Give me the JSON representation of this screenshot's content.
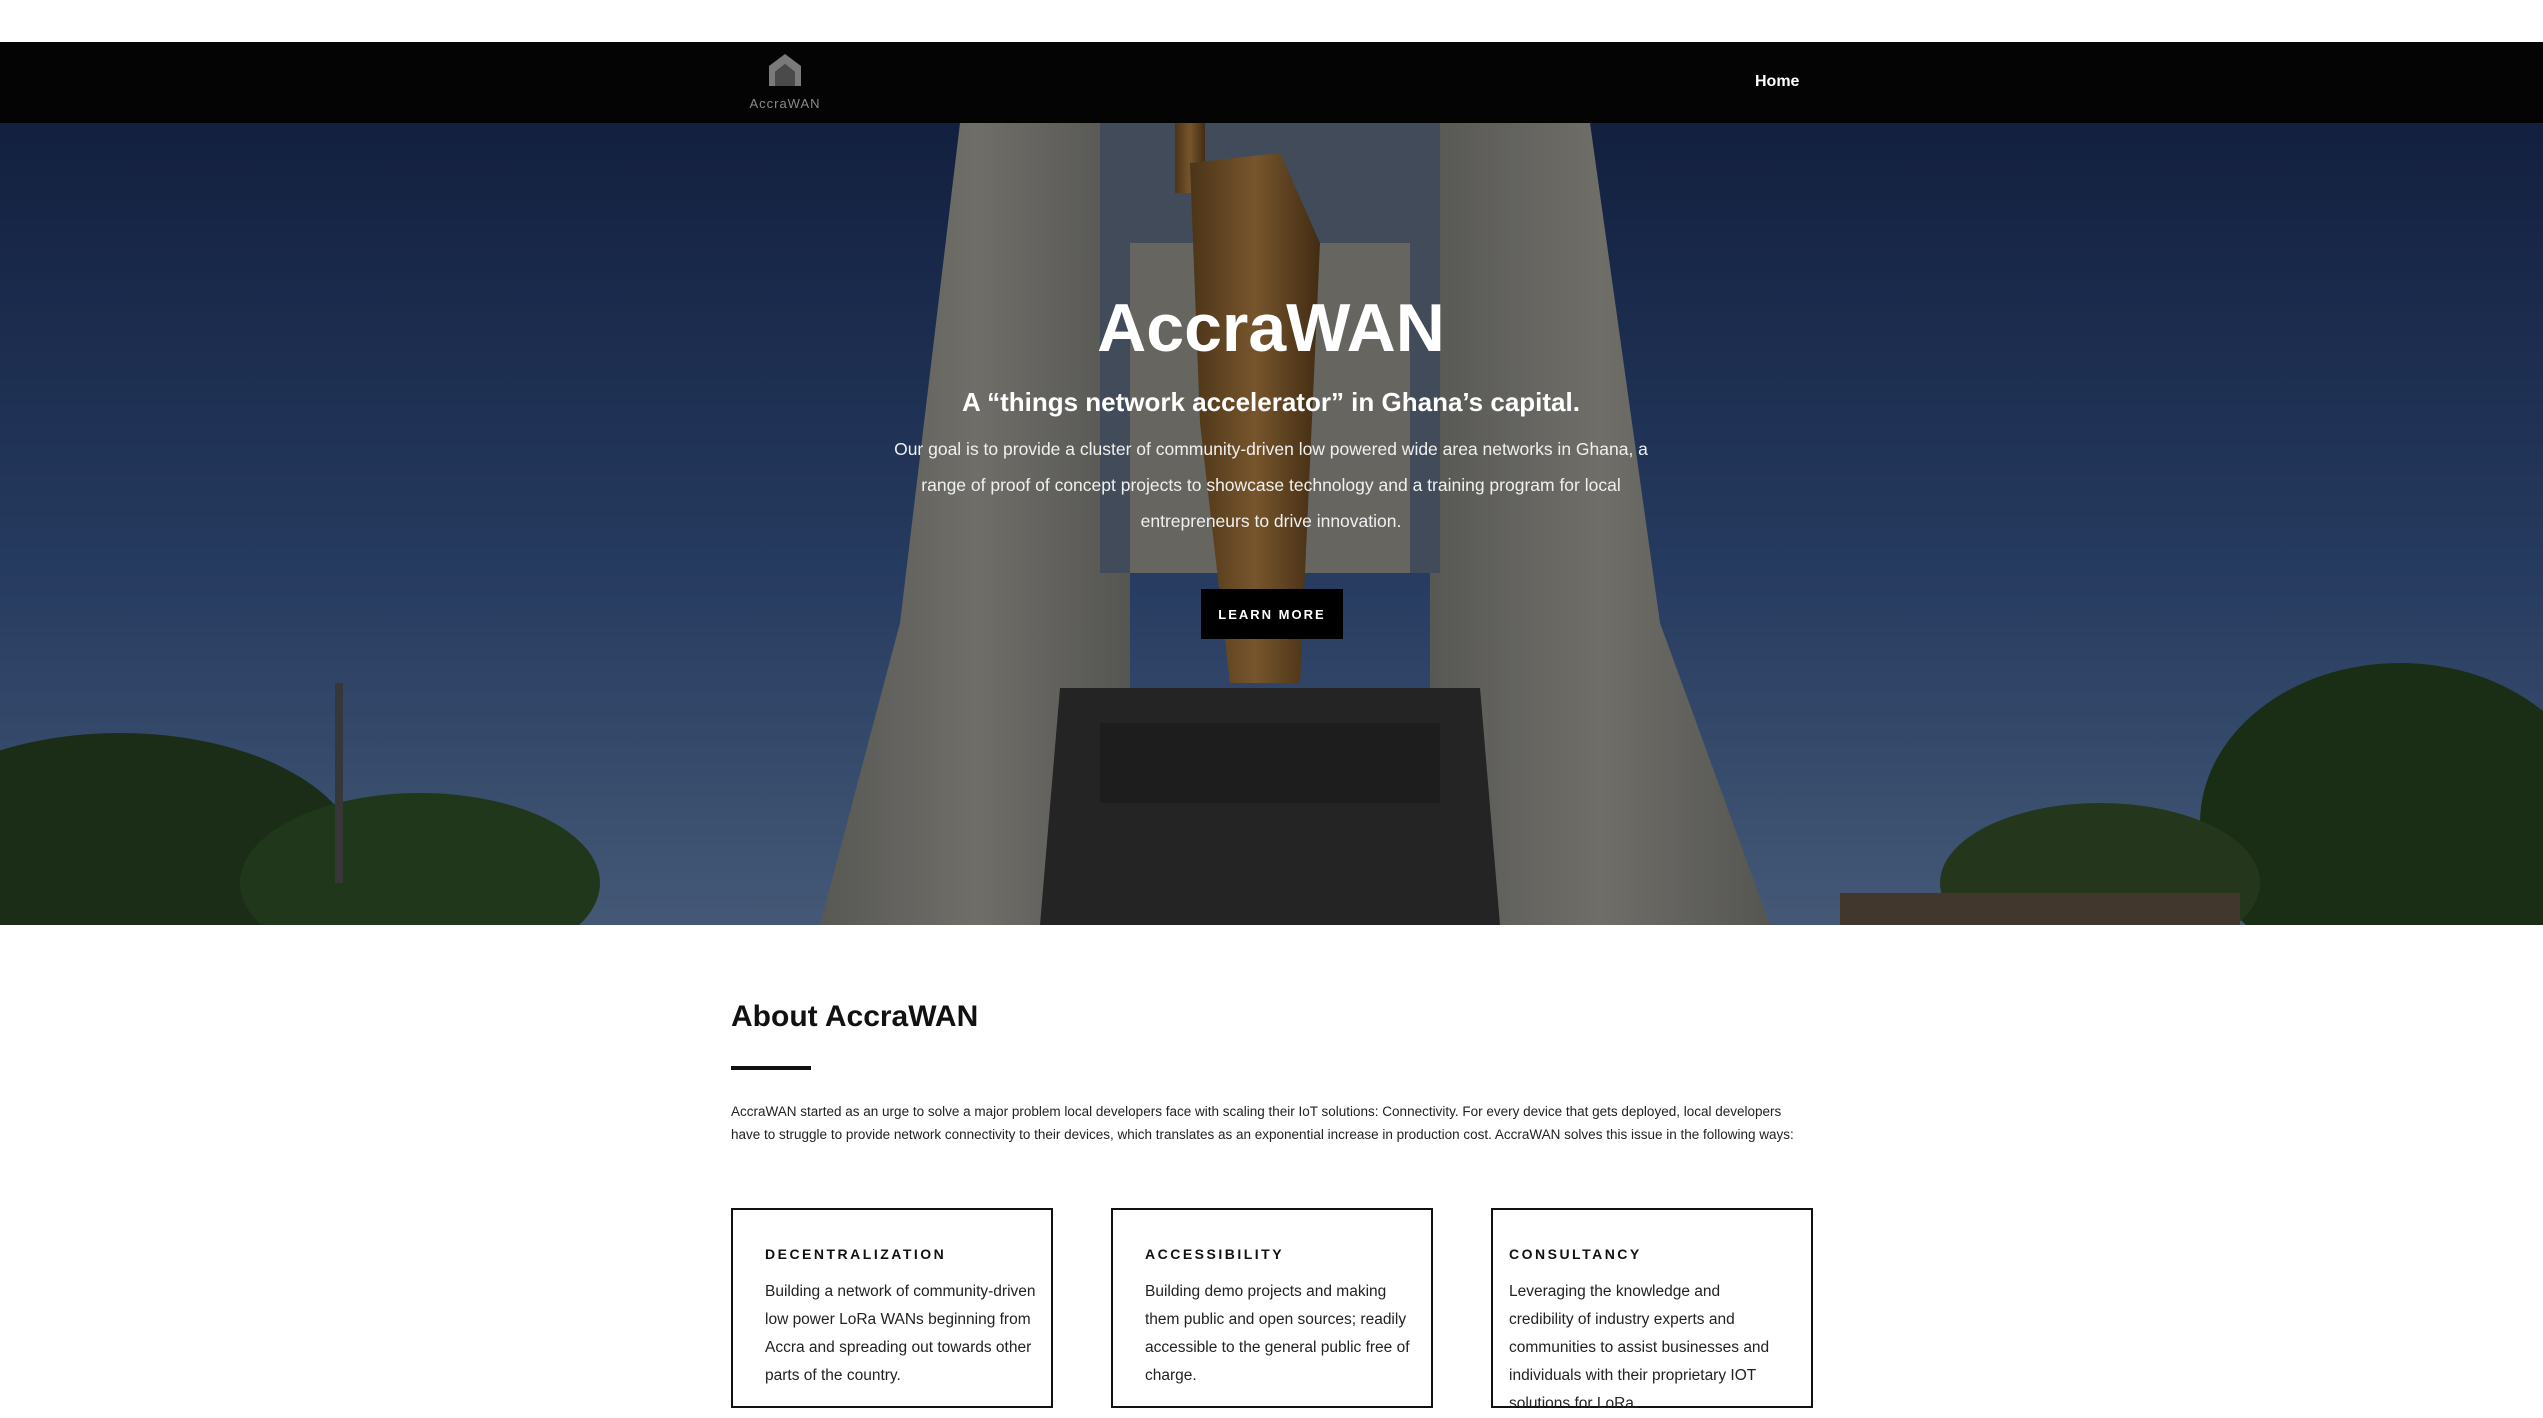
{
  "navbar": {
    "logo_text": "AccraWAN",
    "links": [
      {
        "label": "Home"
      }
    ]
  },
  "hero": {
    "title": "AccraWAN",
    "subtitle": "A “things network accelerator” in Ghana’s capital.",
    "description": "Our goal is to provide a cluster of community-driven low powered wide area networks in Ghana, a range of proof of concept projects to showcase technology and a training program for local entrepreneurs to drive innovation.",
    "cta_label": "LEARN MORE"
  },
  "about": {
    "title": "About AccraWAN",
    "text": "AccraWAN started as an urge to solve a major problem local developers face with scaling their IoT solutions: Connectivity. For every device that gets deployed, local developers have to struggle to provide network connectivity to their devices, which translates as an exponential increase in production cost. AccraWAN solves this issue in the following ways:"
  },
  "cards": [
    {
      "title": "DECENTRALIZATION",
      "body": "Building a network of community-driven low power LoRa WANs beginning from Accra and spreading out towards other parts of the country."
    },
    {
      "title": "ACCESSIBILITY",
      "body": "Building demo projects and making them public and open sources; readily accessible to the general public free of charge."
    },
    {
      "title": "CONSULTANCY",
      "body": "Leveraging the knowledge and credibility of industry experts and communities to assist businesses and individuals with their proprietary IOT solutions for LoRa."
    }
  ],
  "colors": {
    "navbar_bg": "#040404",
    "button_bg": "#000000",
    "text_dark": "#111111"
  },
  "icons": {
    "logo": "arch-logo-icon"
  }
}
